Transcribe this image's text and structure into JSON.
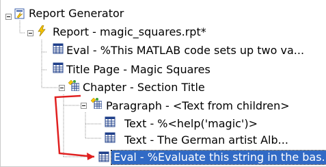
{
  "tree": {
    "nodes": [
      {
        "label": "Report Generator",
        "icon": "report-generator-icon"
      },
      {
        "label": "Report - magic_squares.rpt*",
        "icon": "report-lightning-icon"
      },
      {
        "label": "Eval - %This MATLAB code sets up two va...",
        "icon": "table-icon"
      },
      {
        "label": "Title Page - Magic Squares",
        "icon": "table-icon"
      },
      {
        "label": "Chapter - Section Title",
        "icon": "chapter-icon"
      },
      {
        "label": "Paragraph - <Text from children>",
        "icon": "paragraph-icon"
      },
      {
        "label": "Text - %<help('magic')>",
        "icon": "table-icon"
      },
      {
        "label": "Text - The German artist Alb...",
        "icon": "table-icon"
      },
      {
        "label": "Eval - %Evaluate this string in the bas...",
        "icon": "table-icon",
        "selected": true
      }
    ]
  },
  "annotation": {
    "color": "#e02020"
  },
  "colors": {
    "selection": "#316ac5",
    "tree_lines": "#8c8c8c"
  }
}
